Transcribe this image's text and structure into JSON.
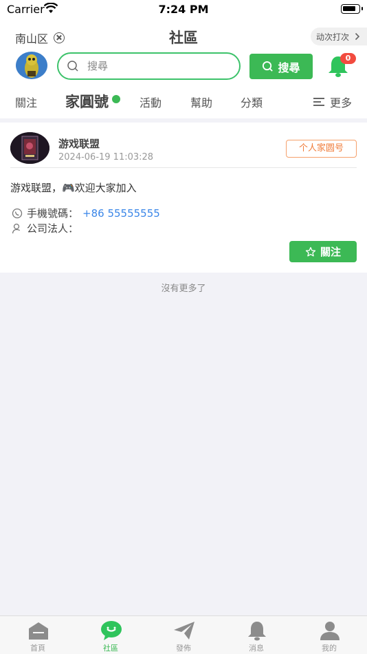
{
  "status_bar": {
    "carrier": "Carrier",
    "time": "7:24 PM"
  },
  "header": {
    "location": "南山区",
    "title": "社區",
    "checkin_label": "动次打次",
    "search": {
      "placeholder": "搜尋",
      "button_label": "搜尋"
    },
    "notification_count": "0"
  },
  "tabs": {
    "items": [
      "關注",
      "家圓號",
      "活動",
      "幫助",
      "分類"
    ],
    "active_index": 1,
    "more_label": "更多"
  },
  "post": {
    "name": "游戏联盟",
    "time": "2024-06-19 11:03:28",
    "badge": "个人家圆号",
    "text": "游戏联盟，🎮欢迎大家加入",
    "phone_label": "手機號碼：",
    "phone_value": "+86 55555555",
    "legal_label": "公司法人：",
    "follow_label": "關注"
  },
  "list_end_text": "沒有更多了",
  "tabbar": {
    "items": [
      "首頁",
      "社區",
      "發佈",
      "消息",
      "我的"
    ],
    "active_index": 1
  },
  "colors": {
    "accent": "#3cb955",
    "badge_red": "#f24b3f",
    "orange": "#f07c3a",
    "link_blue": "#3a86e8"
  }
}
